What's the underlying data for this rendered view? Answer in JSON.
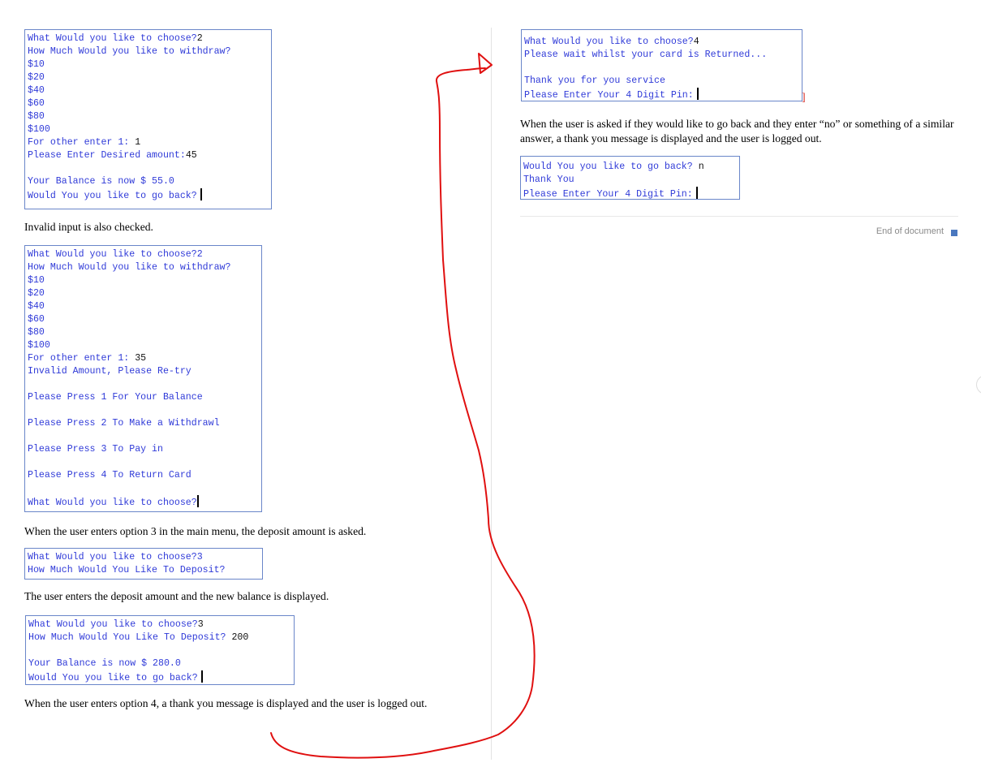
{
  "left_column": {
    "withdraw_console": {
      "lines": [
        {
          "text": "What Would you like to choose?",
          "input": "2"
        },
        {
          "text": "How Much Would you like to withdraw?",
          "input": ""
        },
        {
          "text": "$10",
          "input": ""
        },
        {
          "text": "$20",
          "input": ""
        },
        {
          "text": "$40",
          "input": ""
        },
        {
          "text": "$60",
          "input": ""
        },
        {
          "text": "$80",
          "input": ""
        },
        {
          "text": "$100",
          "input": ""
        },
        {
          "text": "For other enter 1: ",
          "input": "1"
        },
        {
          "text": "Please Enter Desired amount:",
          "input": "45"
        },
        {
          "text": "",
          "input": ""
        },
        {
          "text": "Your Balance is now $ 55.0",
          "input": ""
        },
        {
          "text": "Would You you like to go back?",
          "input": ""
        }
      ]
    },
    "invalid_note": "Invalid input is also checked.",
    "invalid_console": {
      "lines": [
        {
          "text": "What Would you like to choose?2"
        },
        {
          "text": "How Much Would you like to withdraw?"
        },
        {
          "text": "$10"
        },
        {
          "text": "$20"
        },
        {
          "text": "$40"
        },
        {
          "text": "$60"
        },
        {
          "text": "$80"
        },
        {
          "text": "$100"
        },
        {
          "text": "For other enter 1: ",
          "input": "35"
        },
        {
          "text": "Invalid Amount, Please Re-try"
        },
        {
          "text": ""
        },
        {
          "text": "Please Press 1 For Your Balance"
        },
        {
          "text": ""
        },
        {
          "text": "Please Press 2 To Make a Withdrawl"
        },
        {
          "text": ""
        },
        {
          "text": "Please Press 3 To Pay in"
        },
        {
          "text": ""
        },
        {
          "text": "Please Press 4 To Return Card"
        },
        {
          "text": ""
        },
        {
          "text": "What Would you like to choose?"
        }
      ]
    },
    "deposit_note": "When the user enters option 3 in the main menu, the deposit amount is asked.",
    "deposit_ask_console": {
      "lines": [
        {
          "text": "What Would you like to choose?3"
        },
        {
          "text": "How Much Would You Like To Deposit?"
        }
      ]
    },
    "deposit_balance_note": "The user enters the deposit amount and the new balance is displayed.",
    "deposit_result_console": {
      "lines": [
        {
          "text": "What Would you like to choose?",
          "input": "3"
        },
        {
          "text": "How Much Would You Like To Deposit? ",
          "input": "200"
        },
        {
          "text": ""
        },
        {
          "text": "Your Balance is now $ 280.0"
        },
        {
          "text": "Would You you like to go back?"
        }
      ]
    },
    "option4_note": "When the user enters option 4, a thank you message is displayed and the user is logged out."
  },
  "right_column": {
    "return_card_console": {
      "lines": [
        {
          "text": "What Would you like to choose?",
          "input": "4"
        },
        {
          "text": "Please wait whilst your card is Returned..."
        },
        {
          "text": ""
        },
        {
          "text": "Thank you for you service"
        },
        {
          "text": "Please Enter Your 4 Digit Pin:"
        }
      ]
    },
    "stray_mark": "]",
    "go_back_note": "When the user is asked if they would like to go back and they enter “no” or something of a similar answer, a thank you message is displayed and the user is logged out.",
    "logout_console": {
      "lines": [
        {
          "text": "Would You you like to go back? ",
          "input": "n"
        },
        {
          "text": "Thank You"
        },
        {
          "text": "Please Enter Your 4 Digit Pin:"
        }
      ]
    },
    "end_label": "End of document"
  },
  "colors": {
    "console_text": "#2f3ad8",
    "console_border": "#6a86c9",
    "annotation": "#e01010",
    "end_square": "#4a78bf"
  }
}
